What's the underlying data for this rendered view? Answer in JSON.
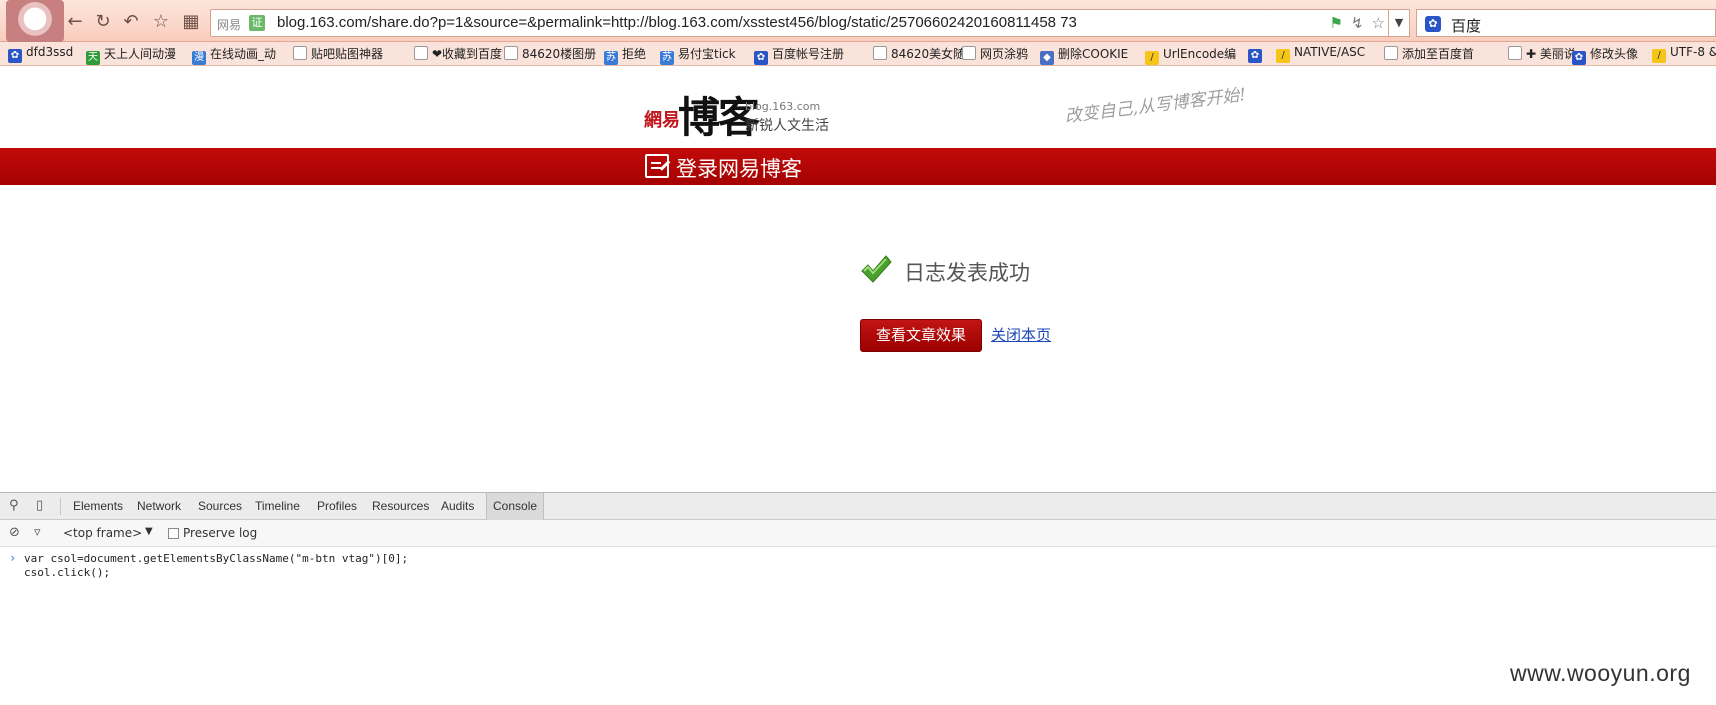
{
  "browser": {
    "url": "blog.163.com/share.do?p=1&source=&permalink=http://blog.163.com/xsstest456/blog/static/25706602420160811458 73",
    "site_badge": "网易",
    "cert_badge": "证",
    "search_engine": "百度",
    "bookmarks": [
      {
        "label": "dfd3ssd",
        "icon": "paw-icon"
      },
      {
        "label": "天上人间动漫",
        "icon": "tian-icon"
      },
      {
        "label": "在线动画_动",
        "icon": "blue-site-icon"
      },
      {
        "label": "贴吧贴图神器",
        "icon": "page-icon"
      },
      {
        "label": "❤收藏到百度",
        "icon": "page-icon"
      },
      {
        "label": "84620楼图册",
        "icon": "page-icon"
      },
      {
        "label": "拒绝",
        "icon": "su-icon"
      },
      {
        "label": "易付宝tick",
        "icon": "su-icon"
      },
      {
        "label": "百度帐号注册",
        "icon": "paw-icon"
      },
      {
        "label": "84620美女随",
        "icon": "page-icon"
      },
      {
        "label": "网页涂鸦",
        "icon": "page-icon"
      },
      {
        "label": "删除COOKIE",
        "icon": "shield-icon"
      },
      {
        "label": "UrlEncode编",
        "icon": "yellow-icon"
      },
      {
        "label": "",
        "icon": "paw-icon"
      },
      {
        "label": "NATIVE/ASC",
        "icon": "yellow-icon"
      },
      {
        "label": "添加至百度首",
        "icon": "page-icon"
      },
      {
        "label": "✚ 美丽说",
        "icon": "page-icon"
      },
      {
        "label": "修改头像",
        "icon": "paw-icon"
      },
      {
        "label": "UTF-8 &",
        "icon": "yellow-icon"
      }
    ]
  },
  "header": {
    "logo_small": "網易",
    "logo_big": "博客",
    "logo_domain": "blog.163.com",
    "logo_tagline": "新锐人文生活",
    "slogan": "改变自己,从写博客开始!"
  },
  "redbar": {
    "login_label": "登录网易博客"
  },
  "main": {
    "success_text": "日志发表成功",
    "view_button": "查看文章效果",
    "close_link": "关闭本页"
  },
  "devtools": {
    "tabs": [
      "Elements",
      "Network",
      "Sources",
      "Timeline",
      "Profiles",
      "Resources",
      "Audits",
      "Console"
    ],
    "active_tab": "Console",
    "frame": "<top frame>",
    "preserve_log": "Preserve log",
    "code_lines": [
      "var csol=document.getElementsByClassName(\"m-btn vtag\")[0];",
      "csol.click();"
    ]
  },
  "watermark": "www.wooyun.org",
  "colors": {
    "brand_red": "#b30000",
    "link_blue": "#1a47b8",
    "check_green": "#4aa02c"
  }
}
